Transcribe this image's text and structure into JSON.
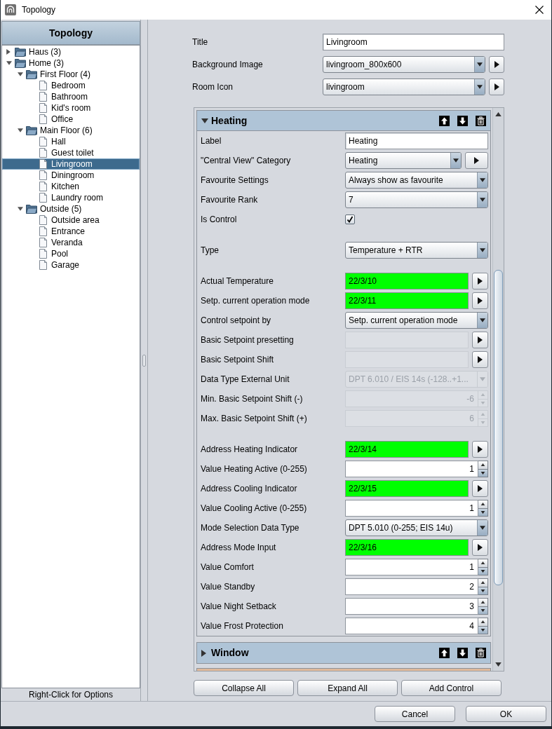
{
  "window": {
    "title": "Topology"
  },
  "topology_panel": {
    "title": "Topology",
    "tree": [
      {
        "label": "Haus (3)",
        "kind": "folder",
        "expanded": false,
        "selected": false
      },
      {
        "label": "Home (3)",
        "kind": "folder",
        "expanded": true,
        "selected": false,
        "children": [
          {
            "label": "First Floor (4)",
            "kind": "folder",
            "expanded": true,
            "selected": false,
            "children": [
              {
                "label": "Bedroom",
                "kind": "room",
                "selected": false
              },
              {
                "label": "Bathroom",
                "kind": "room",
                "selected": false
              },
              {
                "label": "Kid's room",
                "kind": "room",
                "selected": false
              },
              {
                "label": "Office",
                "kind": "room",
                "selected": false
              }
            ]
          },
          {
            "label": "Main Floor (6)",
            "kind": "folder",
            "expanded": true,
            "selected": false,
            "children": [
              {
                "label": "Hall",
                "kind": "room",
                "selected": false
              },
              {
                "label": "Guest toilet",
                "kind": "room",
                "selected": false
              },
              {
                "label": "Livingroom",
                "kind": "room",
                "selected": true
              },
              {
                "label": "Diningroom",
                "kind": "room",
                "selected": false
              },
              {
                "label": "Kitchen",
                "kind": "room",
                "selected": false
              },
              {
                "label": "Laundry room",
                "kind": "room",
                "selected": false
              }
            ]
          },
          {
            "label": "Outside (5)",
            "kind": "folder",
            "expanded": true,
            "selected": false,
            "children": [
              {
                "label": "Outside area",
                "kind": "room",
                "selected": false
              },
              {
                "label": "Entrance",
                "kind": "room",
                "selected": false
              },
              {
                "label": "Veranda",
                "kind": "room",
                "selected": false
              },
              {
                "label": "Pool",
                "kind": "room",
                "selected": false
              },
              {
                "label": "Garage",
                "kind": "room",
                "selected": false
              }
            ]
          }
        ]
      }
    ],
    "footer": "Right-Click for Options"
  },
  "room_form": {
    "fields": [
      {
        "label": "Title",
        "kind": "text",
        "value": "Livingroom"
      },
      {
        "label": "Background Image",
        "kind": "combo_button",
        "value": "livingroom_800x600"
      },
      {
        "label": "Room Icon",
        "kind": "combo_button",
        "value": "livingroom"
      }
    ]
  },
  "controls": [
    {
      "title": "Heating",
      "expanded": true,
      "color": "#afc4d7",
      "field_groups": [
        {
          "fields": [
            {
              "label": "Label",
              "kind": "text",
              "value": "Heating",
              "disabled": false
            },
            {
              "label": "\"Central View\" Category",
              "kind": "combo_button",
              "value": "Heating",
              "disabled": false
            },
            {
              "label": "Favourite Settings",
              "kind": "combo",
              "value": "Always show as favourite",
              "disabled": false
            },
            {
              "label": "Favourite Rank",
              "kind": "combo",
              "value": "7",
              "disabled": false
            },
            {
              "label": "Is Control",
              "kind": "checkbox",
              "checked": true,
              "disabled": false
            }
          ]
        },
        {
          "fields": [
            {
              "label": "Type",
              "kind": "combo",
              "value": "Temperature + RTR",
              "disabled": false
            }
          ]
        },
        {
          "fields": [
            {
              "label": "Actual Temperature",
              "kind": "address",
              "value": "22/3/10",
              "disabled": false
            },
            {
              "label": "Setp. current operation mode",
              "kind": "address",
              "value": "22/3/11",
              "disabled": false
            },
            {
              "label": "Control setpoint by",
              "kind": "combo",
              "value": "Setp. current operation mode",
              "disabled": false
            },
            {
              "label": "Basic Setpoint presetting",
              "kind": "address",
              "disabled": true
            },
            {
              "label": "Basic Setpoint Shift",
              "kind": "address",
              "disabled": true
            },
            {
              "label": "Data Type External Unit",
              "kind": "combo",
              "value": "DPT 6.010 / EIS 14s (-128..+1...",
              "disabled": true
            },
            {
              "label": "Min. Basic Setpoint Shift (-)",
              "kind": "spinner",
              "value": "-6",
              "disabled": true
            },
            {
              "label": "Max. Basic Setpoint Shift (+)",
              "kind": "spinner",
              "value": "6",
              "disabled": true
            }
          ]
        },
        {
          "fields": [
            {
              "label": "Address Heating Indicator",
              "kind": "address",
              "value": "22/3/14",
              "disabled": false
            },
            {
              "label": "Value Heating Active (0-255)",
              "kind": "spinner",
              "value": "1",
              "disabled": false
            },
            {
              "label": "Address Cooling Indicator",
              "kind": "address",
              "value": "22/3/15",
              "disabled": false
            },
            {
              "label": "Value Cooling Active (0-255)",
              "kind": "spinner",
              "value": "1",
              "disabled": false
            },
            {
              "label": "Mode Selection Data Type",
              "kind": "combo",
              "value": "DPT 5.010 (0-255; EIS 14u)",
              "disabled": false
            },
            {
              "label": "Address Mode Input",
              "kind": "address",
              "value": "22/3/16",
              "disabled": false
            },
            {
              "label": "Value Comfort",
              "kind": "spinner",
              "value": "1",
              "disabled": false
            },
            {
              "label": "Value Standby",
              "kind": "spinner",
              "value": "2",
              "disabled": false
            },
            {
              "label": "Value Night Setback",
              "kind": "spinner",
              "value": "3",
              "disabled": false
            },
            {
              "label": "Value Frost Protection",
              "kind": "spinner",
              "value": "4",
              "disabled": false
            }
          ]
        }
      ]
    },
    {
      "title": "Window",
      "expanded": false,
      "color": "#afc4d7"
    },
    {
      "color": "#dfb99b"
    }
  ],
  "control_buttons": [
    "Collapse All",
    "Expand All",
    "Add Control"
  ],
  "dialog_buttons": [
    "Cancel",
    "OK"
  ]
}
